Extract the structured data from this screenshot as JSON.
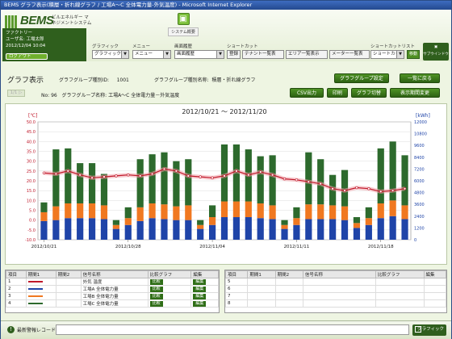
{
  "window": {
    "title": "BEMS グラフ表示(積層・折れ線グラフ / 工場A～C 全体電力量-外気温度) - Microsoft Internet Explorer"
  },
  "header": {
    "brand": "BEMS",
    "brand_tag": "ビルエネルギー マネジメントシステム",
    "system_button": "システム概要",
    "user": {
      "facility": "ファクトリー",
      "user": "ユーザ名: 工場太郎",
      "datetime": "2012/12/04 10:04",
      "logout": "ログアウト"
    }
  },
  "menu": {
    "labels": [
      "グラフィック",
      "メニュー",
      "画面履歴",
      "ショートカット",
      "ショートカットリスト"
    ],
    "graphic": "グラフィック",
    "menu": "メニュー",
    "history": "画面履歴",
    "shortcuts": [
      "登録",
      "テナント一覧表",
      "エリア一覧表示",
      "メーター一覧表"
    ],
    "shortcut_list": "ショートカット",
    "go": "移動",
    "size_btn": "サブウインドウ"
  },
  "graph": {
    "title": "グラフ表示",
    "group_type_label": "グラフグループ種別ID:",
    "group_type_value": "1001",
    "group_name_label": "グラフグループ種別名称:",
    "group_name_value": "積層・折れ線グラフ",
    "btn_settings": "グラフグループ設定",
    "btn_back": "一覧に戻る",
    "nav": "1/1 ▷",
    "no_label": "No: 96",
    "name_label": "グラフグループ名称:",
    "name_value": "工場A～C 全体電力量－外気温度",
    "btn_csv": "CSV出力",
    "btn_print": "印刷",
    "btn_switch": "グラフ切替",
    "btn_period": "表示期間変更"
  },
  "chart_data": {
    "type": "bar",
    "title": "2012/10/21 ～ 2012/11/20",
    "ylabel_left": "[℃]",
    "ylabel_right": "[kWh]",
    "y_left_ticks": [
      "-10.0",
      "-5.0",
      "0.0",
      "5.0",
      "10.0",
      "15.0",
      "20.0",
      "25.0",
      "30.0",
      "35.0",
      "40.0",
      "45.0",
      "50.0"
    ],
    "y_right_ticks": [
      "0",
      "1200",
      "2400",
      "3600",
      "4800",
      "6000",
      "7200",
      "8400",
      "9600",
      "10800",
      "12000"
    ],
    "y_left_range": [
      -10,
      50
    ],
    "y_right_range": [
      0,
      12000
    ],
    "x_labels": [
      "2012/10/21",
      "2012/10/28",
      "2012/11/04",
      "2012/11/11",
      "2012/11/18"
    ],
    "categories": [
      "10/21",
      "10/22",
      "10/23",
      "10/24",
      "10/25",
      "10/26",
      "10/27",
      "10/28",
      "10/29",
      "10/30",
      "10/31",
      "11/01",
      "11/02",
      "11/03",
      "11/04",
      "11/05",
      "11/06",
      "11/07",
      "11/08",
      "11/09",
      "11/10",
      "11/11",
      "11/12",
      "11/13",
      "11/14",
      "11/15",
      "11/16",
      "11/17",
      "11/18",
      "11/19",
      "11/20"
    ],
    "series": [
      {
        "name": "工場A 全体電力量",
        "color": "#1f44a8",
        "values": [
          1900,
          2000,
          2200,
          2200,
          2200,
          2100,
          1100,
          1500,
          1900,
          2200,
          2100,
          2000,
          2000,
          1100,
          1500,
          2300,
          2300,
          2300,
          2200,
          2100,
          1100,
          1500,
          2100,
          2100,
          2100,
          2000,
          1200,
          1500,
          2200,
          2400,
          2100
        ]
      },
      {
        "name": "工場B 全体電力量",
        "color": "#f07820",
        "values": [
          900,
          1400,
          1500,
          1500,
          1500,
          1400,
          400,
          700,
          1400,
          1500,
          1500,
          1400,
          1500,
          400,
          800,
          1600,
          1600,
          1600,
          1500,
          1400,
          400,
          700,
          1500,
          1500,
          1400,
          1400,
          500,
          700,
          1500,
          1600,
          1400
        ]
      },
      {
        "name": "工場C 全体電力量",
        "color": "#2d6a2d",
        "values": [
          1000,
          5800,
          5600,
          4100,
          4100,
          3200,
          500,
          1100,
          4900,
          5000,
          5300,
          4600,
          4700,
          500,
          1200,
          5800,
          5800,
          5300,
          4800,
          5100,
          500,
          1100,
          5300,
          4600,
          3100,
          3700,
          600,
          1100,
          5600,
          6000,
          5100
        ]
      }
    ],
    "line": {
      "name": "外気温度",
      "color": "#c0182a",
      "unit": "℃",
      "values": [
        24,
        23.5,
        25,
        23,
        21.5,
        22,
        22.5,
        23,
        22.5,
        23.5,
        26,
        25,
        22.5,
        22,
        21.5,
        22.5,
        25,
        23,
        24.5,
        23,
        21,
        20.5,
        19.5,
        18.5,
        16,
        15,
        16.5,
        16,
        14.5,
        15,
        16
      ]
    },
    "grid": true,
    "legend": "table-bottom"
  },
  "table_left": {
    "headers": [
      "項目",
      "期間1",
      "期間2",
      "信号名称",
      "比較グラフ",
      "編集"
    ],
    "rows": [
      {
        "no": "1",
        "color": "#c0182a",
        "name": "外気 温度",
        "compare": "比較",
        "edit": "編集"
      },
      {
        "no": "2",
        "color": "#1f44a8",
        "name": "工場A 全体電力量",
        "compare": "比較",
        "edit": "編集"
      },
      {
        "no": "3",
        "color": "#f07820",
        "name": "工場B 全体電力量",
        "compare": "比較",
        "edit": "編集"
      },
      {
        "no": "4",
        "color": "#2d6a2d",
        "name": "工場C 全体電力量",
        "compare": "比較",
        "edit": "編集"
      }
    ]
  },
  "table_right": {
    "headers": [
      "項目",
      "期間1",
      "期間2",
      "信号名称",
      "比較グラフ",
      "編集"
    ],
    "rows": [
      "5",
      "6",
      "7",
      "8"
    ]
  },
  "status": {
    "alarm_label": "最新警報レコード",
    "graphic_button": "グラフィック"
  }
}
